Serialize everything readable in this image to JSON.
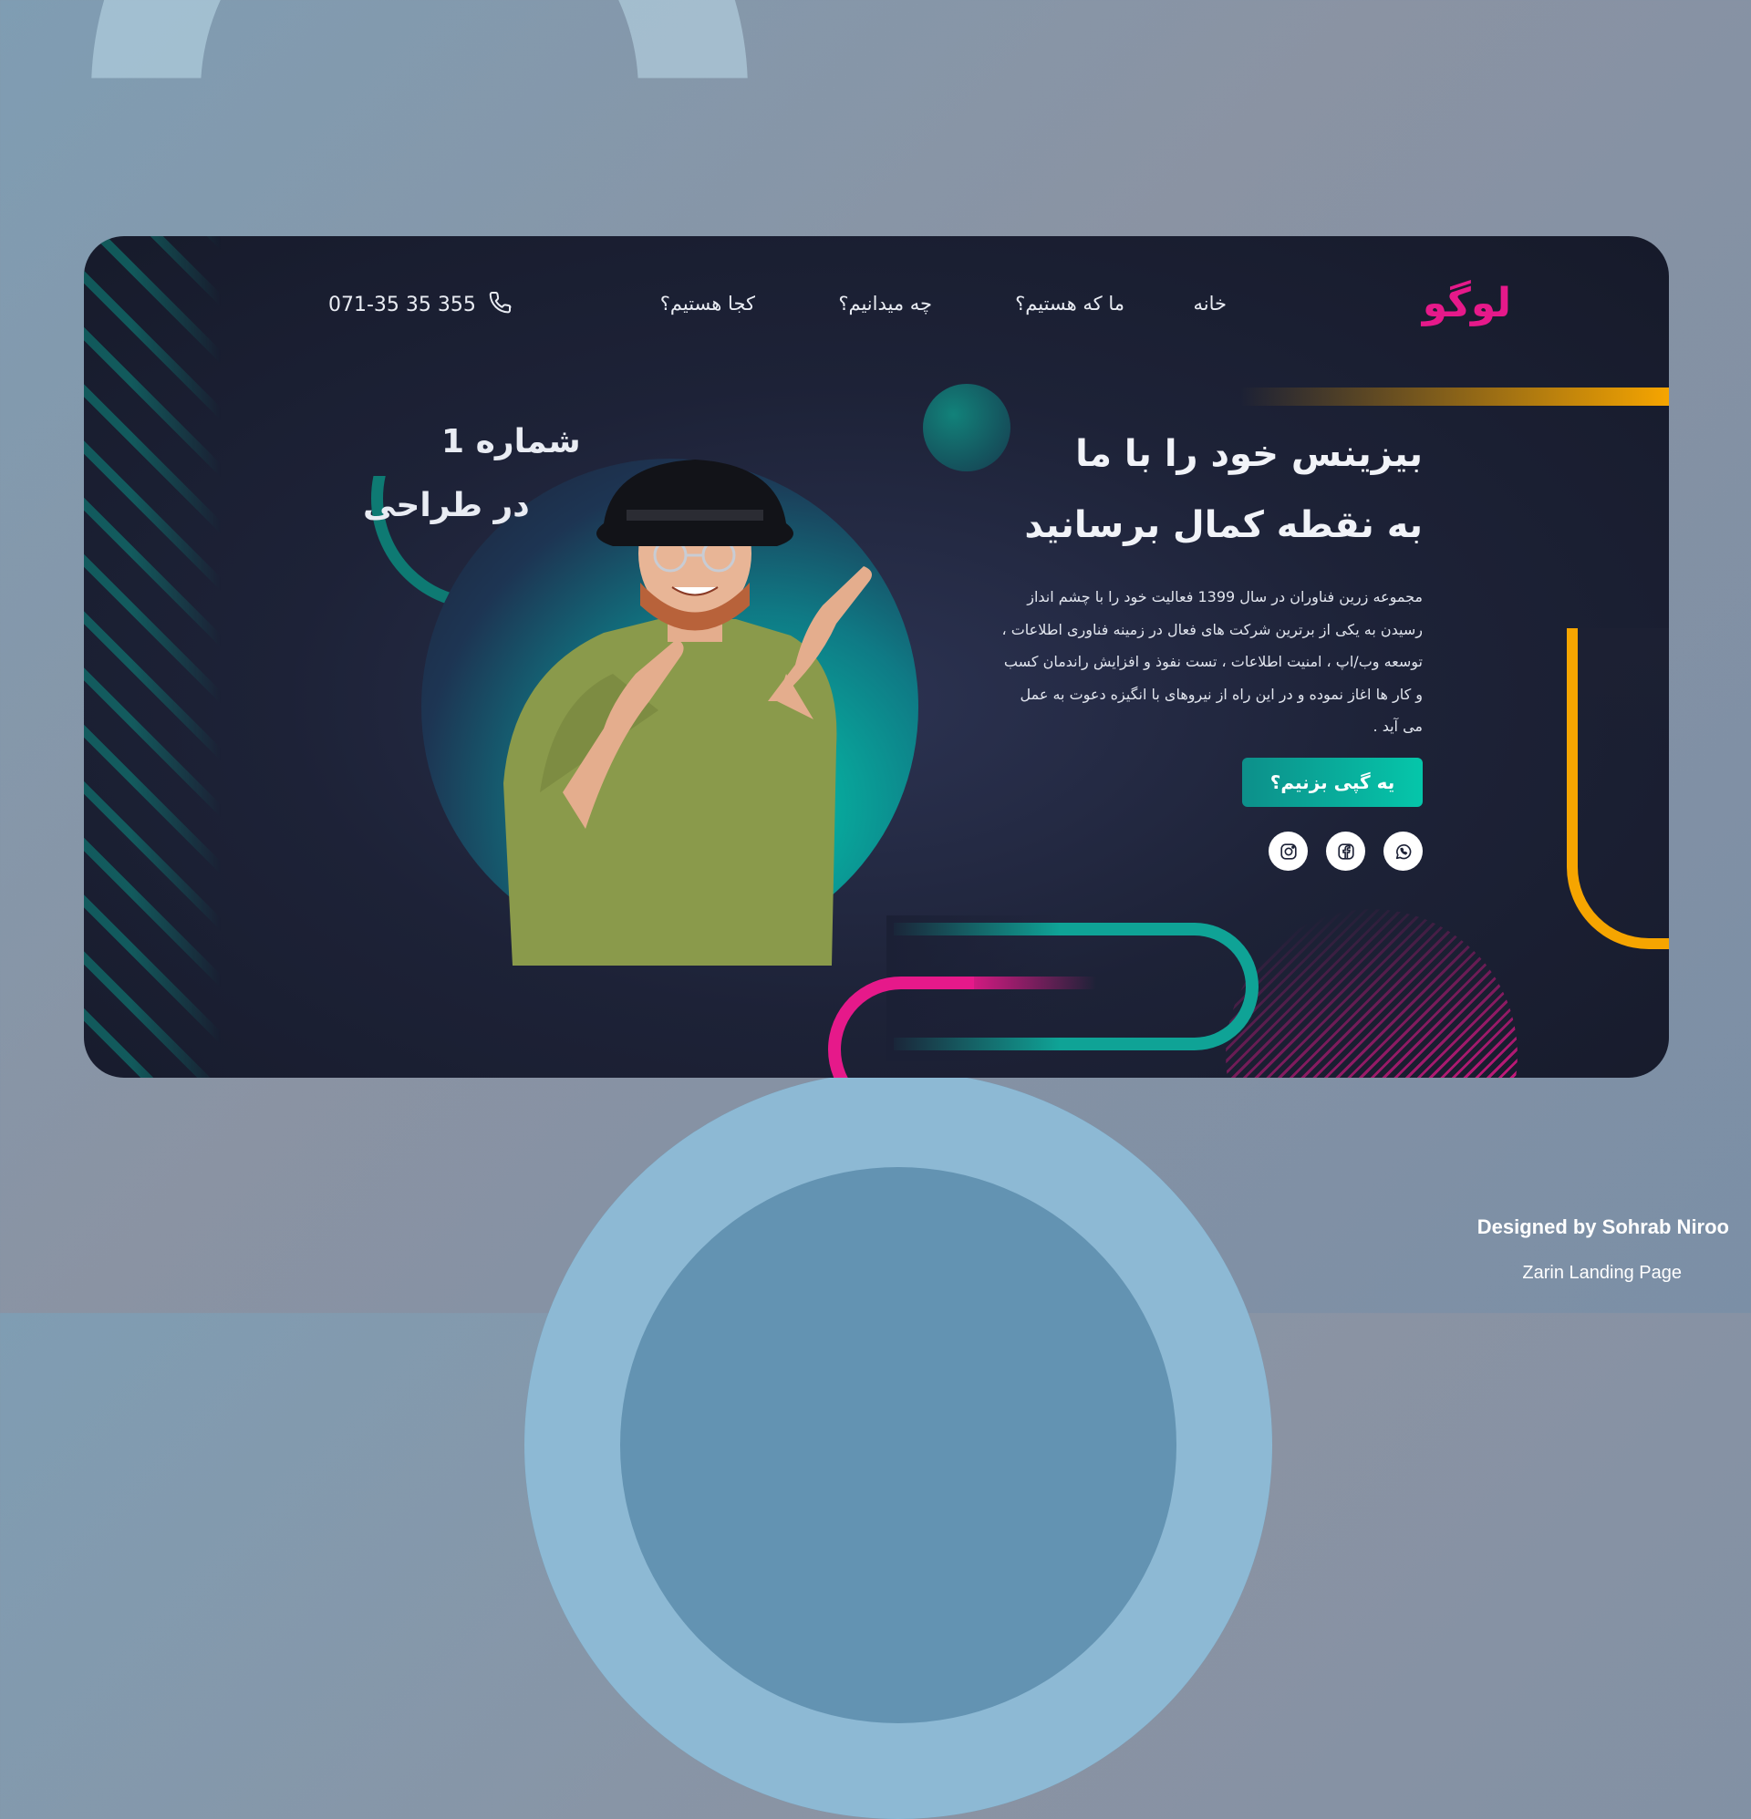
{
  "header": {
    "logo": "لوگو",
    "nav": [
      "خانه",
      "ما که هستیم؟",
      "چه میدانیم؟",
      "کجا هستیم؟"
    ],
    "phone": "071-35 35 355"
  },
  "hero": {
    "tagline_line1": "شماره 1",
    "tagline_line2": "در طراحی",
    "headline_line1": "بیزینس خود را با ما",
    "headline_line2": "به نقطه کمال برسانید",
    "body": [
      "مجموعه زرین فناوران در سال 1399 فعالیت خود را با چشم انداز",
      "رسیدن به یکی از برترین شرکت های فعال در زمینه فناوری اطلاعات ،",
      "توسعه وب/اپ ، امنیت اطلاعات ، تست نفوذ و افزایش راندمان کسب",
      "و کار ها اغاز نموده و در این راه از نیروهای با انگیزه دعوت به عمل",
      "می آید ."
    ],
    "cta_label": "یه گپی بزنیم؟",
    "socials": [
      "whatsapp-icon",
      "facebook-icon",
      "instagram-icon"
    ]
  },
  "credits": {
    "author": "Designed by Sohrab Niroo",
    "title": "Zarin Landing Page"
  },
  "colors": {
    "accent_pink": "#e6198a",
    "accent_teal": "#05c6aa",
    "accent_orange": "#f6a500",
    "card_bg": "#1d2237"
  }
}
